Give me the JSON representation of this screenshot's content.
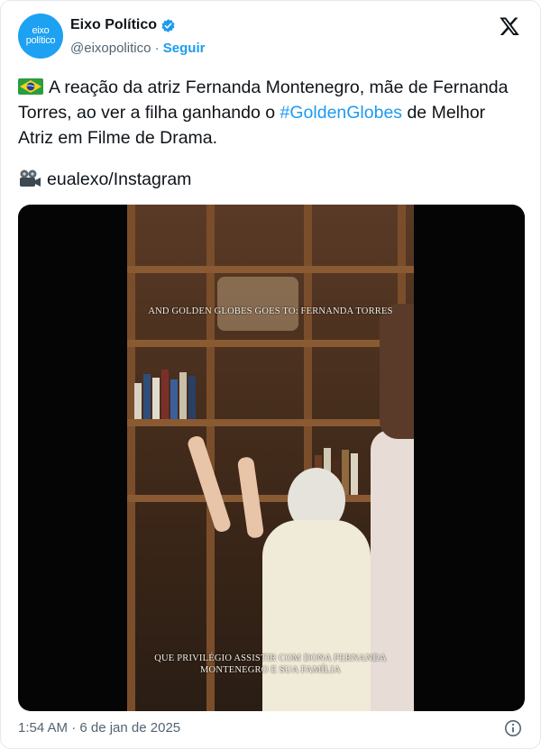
{
  "author": {
    "avatar_text_line1": "eixo",
    "avatar_text_line2": "político",
    "name": "Eixo Político",
    "handle": "@eixopolitico",
    "separator": "·",
    "follow_label": "Seguir"
  },
  "icons": {
    "verified": "verified-badge-icon",
    "platform": "x-logo-icon",
    "flag": "brazil-flag-icon",
    "camera": "movie-camera-icon",
    "info": "info-icon"
  },
  "tweet": {
    "text_part1": "A reação da atriz Fernanda Montenegro, mãe de Fernanda Torres, ao ver a filha ganhando o ",
    "hashtag": "#GoldenGlobes",
    "text_part2": " de Melhor Atriz em Filme de Drama.",
    "source": "eualexo/Instagram"
  },
  "video": {
    "caption_top": "AND GOLDEN GLOBES GOES TO: FERNANDA TORRES",
    "caption_bottom_line1": "QUE PRIVILÉGIO ASSISTIR COM DONA FERNANDA",
    "caption_bottom_line2": "MONTENEGRO E SUA FAMÍLIA"
  },
  "footer": {
    "timestamp": "1:54 AM · 6 de jan de 2025"
  },
  "colors": {
    "accent": "#1d9bf0",
    "secondary_text": "#536471",
    "primary_text": "#0f1419"
  }
}
